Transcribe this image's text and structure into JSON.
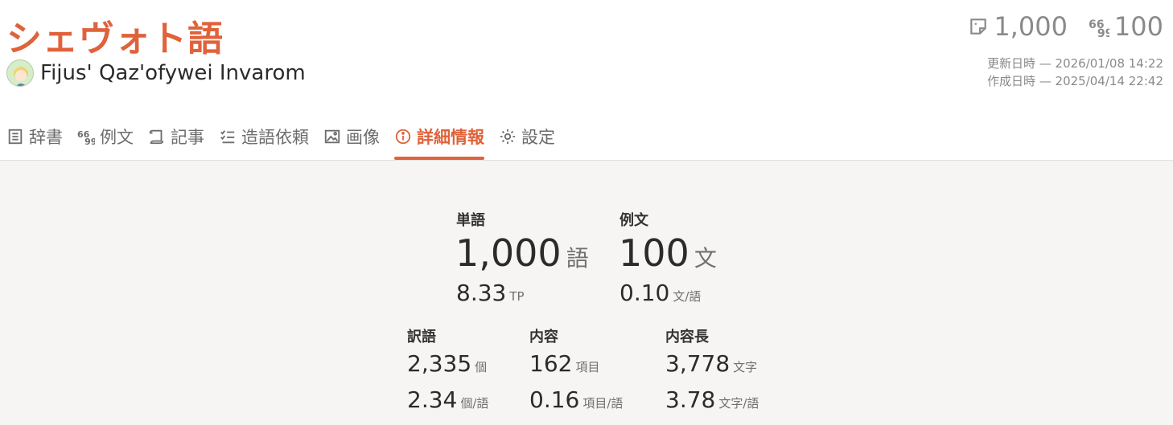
{
  "header": {
    "title": "シェヴォト語",
    "author": "Fijus' Qaz'ofywei Invarom",
    "word_count": "1,000",
    "example_count": "100",
    "updated_label": "更新日時 — 2026/01/08 14:22",
    "created_label": "作成日時 — 2025/04/14 22:42"
  },
  "tabs": [
    {
      "label": "辞書",
      "icon": "dictionary-icon"
    },
    {
      "label": "例文",
      "icon": "quote-icon"
    },
    {
      "label": "記事",
      "icon": "scroll-icon"
    },
    {
      "label": "造語依頼",
      "icon": "checklist-icon"
    },
    {
      "label": "画像",
      "icon": "image-icon"
    },
    {
      "label": "詳細情報",
      "icon": "info-icon",
      "active": true
    },
    {
      "label": "設定",
      "icon": "gear-icon"
    }
  ],
  "stats": {
    "words": {
      "label": "単語",
      "value": "1,000",
      "unit": "語",
      "sub_value": "8.33",
      "sub_unit": "TP"
    },
    "examples": {
      "label": "例文",
      "value": "100",
      "unit": "文",
      "sub_value": "0.10",
      "sub_unit": "文/語"
    },
    "translations": {
      "label": "訳語",
      "value": "2,335",
      "unit": "個",
      "sub_value": "2.34",
      "sub_unit": "個/語"
    },
    "contents": {
      "label": "内容",
      "value": "162",
      "unit": "項目",
      "sub_value": "0.16",
      "sub_unit": "項目/語"
    },
    "content_length": {
      "label": "内容長",
      "value": "3,778",
      "unit": "文字",
      "sub_value": "3.78",
      "sub_unit": "文字/語"
    }
  },
  "colors": {
    "accent": "#e0623a",
    "muted": "#8a8a8a",
    "background": "#f6f5f3"
  }
}
